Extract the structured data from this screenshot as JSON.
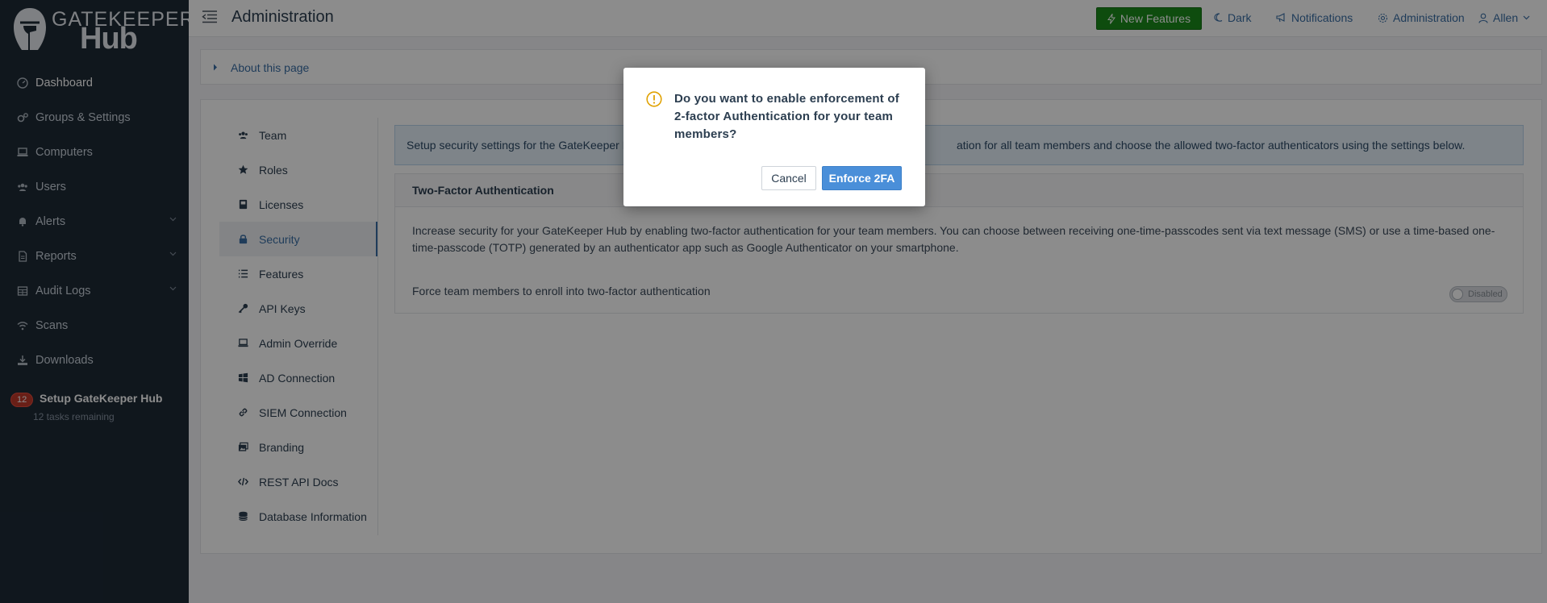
{
  "logo": {
    "line1": "GATEKEEPER",
    "line2": "Hub"
  },
  "sidebar": {
    "items": [
      {
        "label": "Dashboard",
        "icon": "gauge-icon"
      },
      {
        "label": "Groups & Settings",
        "icon": "cogs-icon"
      },
      {
        "label": "Computers",
        "icon": "laptop-icon"
      },
      {
        "label": "Users",
        "icon": "users-icon"
      },
      {
        "label": "Alerts",
        "icon": "bell-icon"
      },
      {
        "label": "Reports",
        "icon": "document-icon"
      },
      {
        "label": "Audit Logs",
        "icon": "table-icon"
      },
      {
        "label": "Scans",
        "icon": "wifi-icon"
      },
      {
        "label": "Downloads",
        "icon": "download-icon"
      }
    ],
    "setup": {
      "badge": "12",
      "title": "Setup GateKeeper Hub",
      "subtitle": "12 tasks remaining"
    }
  },
  "header": {
    "title": "Administration",
    "new_features": "New Features",
    "dark": "Dark",
    "notifications": "Notifications",
    "administration": "Administration",
    "user": "Allen"
  },
  "about": {
    "label": "About this page"
  },
  "subnav": {
    "items": [
      {
        "label": "Team",
        "icon": "users-icon"
      },
      {
        "label": "Roles",
        "icon": "star-icon"
      },
      {
        "label": "Licenses",
        "icon": "license-icon"
      },
      {
        "label": "Security",
        "icon": "lock-icon"
      },
      {
        "label": "Features",
        "icon": "list-icon"
      },
      {
        "label": "API Keys",
        "icon": "key-icon"
      },
      {
        "label": "Admin Override",
        "icon": "laptop-icon"
      },
      {
        "label": "AD Connection",
        "icon": "windows-icon"
      },
      {
        "label": "SIEM Connection",
        "icon": "link-icon"
      },
      {
        "label": "Branding",
        "icon": "images-icon"
      },
      {
        "label": "REST API Docs",
        "icon": "code-icon"
      },
      {
        "label": "Database Information",
        "icon": "database-icon"
      }
    ],
    "active": "Security"
  },
  "security": {
    "info_left": "Setup security settings for the GateKeeper Hu",
    "info_right": "ation for all team members and choose the allowed two-factor authenticators using the settings below.",
    "twofa_title": "Two-Factor Authentication",
    "twofa_desc": "Increase security for your GateKeeper Hub by enabling two-factor authentication for your team members. You can choose between receiving one-time-passcodes sent via text message (SMS) or use a time-based one-time-passcode (TOTP) generated by an authenticator app such as Google Authenticator on your smartphone.",
    "force_label": "Force team members to enroll into two-factor authentication",
    "toggle_state": "Disabled"
  },
  "modal": {
    "message": "Do you want to enable enforcement of 2-factor Authentication for your team members?",
    "cancel": "Cancel",
    "confirm": "Enforce 2FA",
    "icon_color": "#e0a100"
  }
}
